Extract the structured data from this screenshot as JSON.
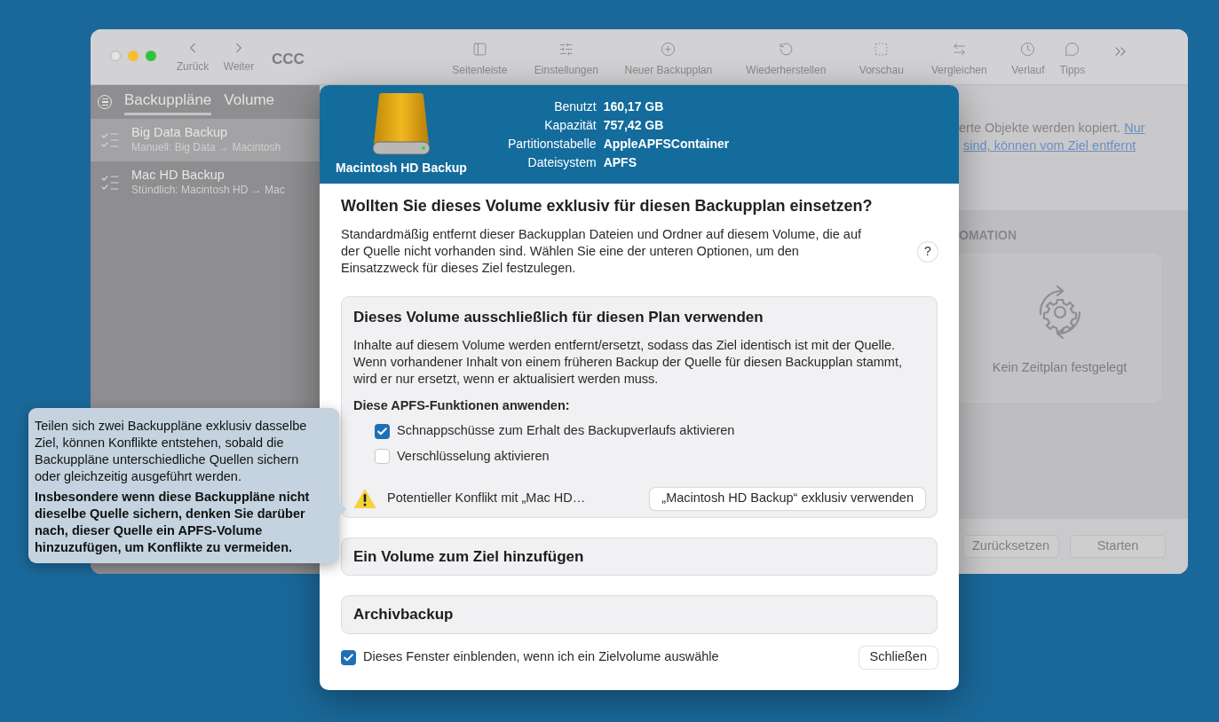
{
  "window": {
    "title": "CCC",
    "nav": [
      {
        "label": "Zurück",
        "kind": "back"
      },
      {
        "label": "Weiter",
        "kind": "forward"
      }
    ],
    "toolbar": [
      {
        "label": "Seitenleiste",
        "kind": "sidebar"
      },
      {
        "label": "Einstellungen",
        "kind": "settings"
      },
      {
        "label": "Neuer Backupplan",
        "kind": "add"
      },
      {
        "label": "Wiederherstellen",
        "kind": "restore"
      },
      {
        "label": "Vorschau",
        "kind": "preview"
      },
      {
        "label": "Vergleichen",
        "kind": "compare"
      },
      {
        "label": "Verlauf",
        "kind": "history"
      },
      {
        "label": "Tipps",
        "kind": "tips"
      }
    ]
  },
  "sidebar": {
    "tabs": [
      {
        "label": "Backuppläne",
        "selected": true
      },
      {
        "label": "Volume",
        "selected": false
      }
    ],
    "items": [
      {
        "name": "Big Data Backup",
        "detail": "Manuell: Big Data → Macintosh",
        "selected": true
      },
      {
        "name": "Mac HD Backup",
        "detail": "Stündlich: Macintosh HD → Mac",
        "selected": false
      }
    ]
  },
  "content": {
    "text_line_1": "erte Objekte werden kopiert.",
    "link_1": "Nur",
    "link_2": "sind, können vom Ziel entfernt",
    "section_heading": "OMATION",
    "schedule_empty": "Kein Zeitplan festgelegt",
    "buttons": [
      "Zurücksetzen",
      "Starten"
    ]
  },
  "dialog": {
    "volume_name": "Macintosh HD Backup",
    "info": [
      {
        "label": "Benutzt",
        "value": "160,17 GB"
      },
      {
        "label": "Kapazität",
        "value": "757,42 GB"
      },
      {
        "label": "Partitionstabelle",
        "value": "AppleAPFSContainer"
      },
      {
        "label": "Dateisystem",
        "value": "APFS"
      }
    ],
    "title": "Wollten Sie dieses Volume exklusiv für diesen Backupplan einsetzen?",
    "intro": "Standardmäßig entfernt dieser Backupplan Dateien und Ordner auf diesem Volume, die auf der Quelle nicht vorhanden sind. Wählen Sie eine der unteren Optionen, um den Einsatzzweck für dieses Ziel festzulegen.",
    "help": "?",
    "options": [
      {
        "title": "Dieses Volume ausschließlich für diesen Plan verwenden",
        "expanded": true,
        "description": "Inhalte auf diesem Volume werden entfernt/ersetzt, sodass das Ziel identisch ist mit der Quelle. Wenn vorhandener Inhalt von einem früheren Backup der Quelle für diesen Backupplan stammt, wird er nur ersetzt, wenn er aktualisiert werden muss.",
        "features_heading": "Diese APFS-Funktionen anwenden:",
        "features": [
          {
            "label": "Schnappschüsse zum Erhalt des Backupverlaufs aktivieren",
            "checked": true
          },
          {
            "label": "Verschlüsselung aktivieren",
            "checked": false
          }
        ],
        "warning": "Potentieller Konflikt mit „Mac HD…",
        "action": "„Macintosh HD Backup“ exklusiv verwenden"
      },
      {
        "title": "Ein Volume zum Ziel hinzufügen",
        "expanded": false
      },
      {
        "title": "Archivbackup",
        "expanded": false
      }
    ],
    "show_again": {
      "label": "Dieses Fenster einblenden, wenn ich ein Zielvolume auswähle",
      "checked": true
    },
    "close": "Schließen"
  },
  "tooltip": {
    "text": "Teilen sich zwei Backuppläne exklusiv dasselbe Ziel, können Konflikte entstehen, sobald die Backuppläne unterschiedliche Quellen sichern oder gleichzeitig ausgeführt werden.",
    "bold_text": "Insbesondere wenn diese Backuppläne nicht dieselbe Quelle sichern, denken Sie darüber nach, dieser Quelle ein APFS-Volume hinzuzufügen, um Konflikte zu vermeiden."
  }
}
